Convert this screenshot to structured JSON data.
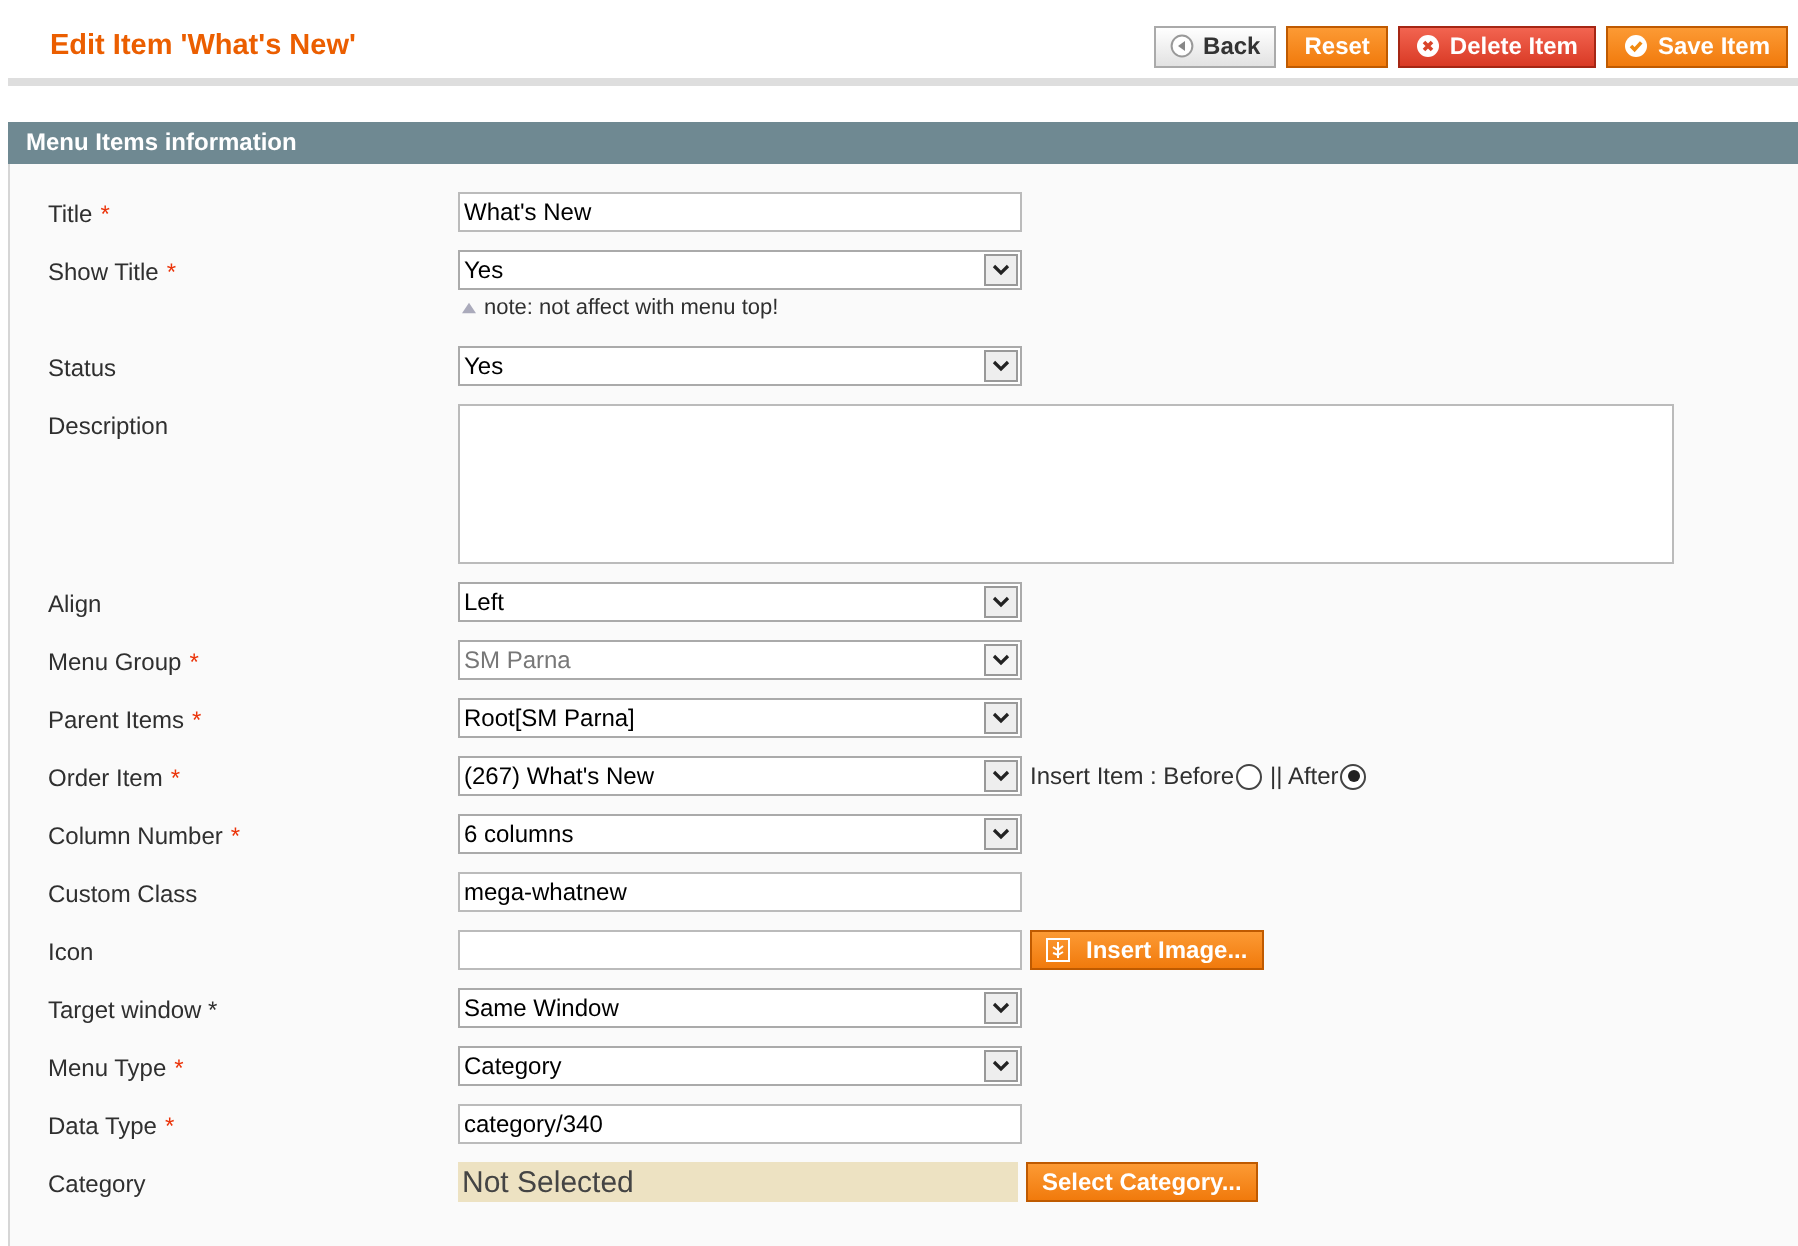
{
  "page_title": "Edit Item 'What's New'",
  "buttons": [
    {
      "label": "Back",
      "kind": "back"
    },
    {
      "label": "Reset",
      "kind": "reset"
    },
    {
      "label": "Delete Item",
      "kind": "delete"
    },
    {
      "label": "Save Item",
      "kind": "save"
    }
  ],
  "section": {
    "title": "Menu Items information"
  },
  "required_marker": "*",
  "fields": [
    {
      "label": "Title",
      "required": true,
      "kind": "text",
      "value": "What's New"
    },
    {
      "label": "Show Title",
      "required": true,
      "kind": "select",
      "value": "Yes",
      "note": "note: not affect with menu top!"
    },
    {
      "label": "Status",
      "required": false,
      "kind": "select",
      "value": "Yes"
    },
    {
      "label": "Description",
      "required": false,
      "kind": "textarea"
    },
    {
      "label": "Align",
      "required": false,
      "kind": "select",
      "value": "Left"
    },
    {
      "label": "Menu Group",
      "required": true,
      "kind": "select",
      "value": "SM Parna",
      "disabled": true
    },
    {
      "label": "Parent Items",
      "required": true,
      "kind": "select",
      "value": "Root[SM Parna]"
    },
    {
      "label": "Order Item",
      "required": true,
      "kind": "select",
      "value": "(267) What's New",
      "extra": {
        "label": "Insert Item : Before",
        "options": [
          {
            "selected": false
          },
          {
            "label": "|| After",
            "selected": true
          }
        ]
      }
    },
    {
      "label": "Column Number",
      "required": true,
      "kind": "select",
      "value": "6 columns"
    },
    {
      "label": "Custom Class",
      "required": false,
      "kind": "text",
      "value": "mega-whatnew"
    },
    {
      "label": "Icon",
      "required": false,
      "kind": "text",
      "button": "Insert Image..."
    },
    {
      "label": "Target window *",
      "required": false,
      "kind": "select",
      "value": "Same Window"
    },
    {
      "label": "Menu Type",
      "required": true,
      "kind": "select",
      "value": "Category"
    },
    {
      "label": "Data Type",
      "required": true,
      "kind": "text",
      "value": "category/340"
    },
    {
      "label": "Category",
      "required": false,
      "kind": "chooser",
      "value": "Not Selected",
      "button": "Select Category..."
    }
  ]
}
